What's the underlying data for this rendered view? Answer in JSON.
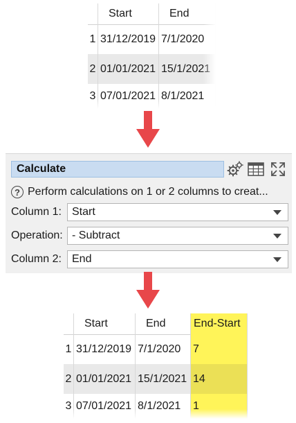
{
  "input_table": {
    "columns": [
      "",
      "Start",
      "End"
    ],
    "rows": [
      [
        "1",
        "31/12/2019",
        "7/1/2020"
      ],
      [
        "2",
        "01/01/2021",
        "15/1/2021"
      ],
      [
        "3",
        "07/01/2021",
        "8/1/2021"
      ]
    ]
  },
  "calculate_panel": {
    "title": "Calculate",
    "description": "Perform calculations on 1 or 2 columns to creat...",
    "fields": [
      {
        "label": "Column 1:",
        "value": "Start"
      },
      {
        "label": "Operation:",
        "value": "- Subtract"
      },
      {
        "label": "Column 2:",
        "value": "End"
      }
    ],
    "icons": [
      "gear-icon",
      "table-icon",
      "expand-icon"
    ]
  },
  "output_table": {
    "columns": [
      "",
      "Start",
      "End",
      "End-Start"
    ],
    "rows": [
      [
        "1",
        "31/12/2019",
        "7/1/2020",
        "7"
      ],
      [
        "2",
        "01/01/2021",
        "15/1/2021",
        "14"
      ],
      [
        "3",
        "07/01/2021",
        "8/1/2021",
        "1"
      ]
    ],
    "highlight_color": "#fff459"
  },
  "arrow_color": "#e8474a"
}
